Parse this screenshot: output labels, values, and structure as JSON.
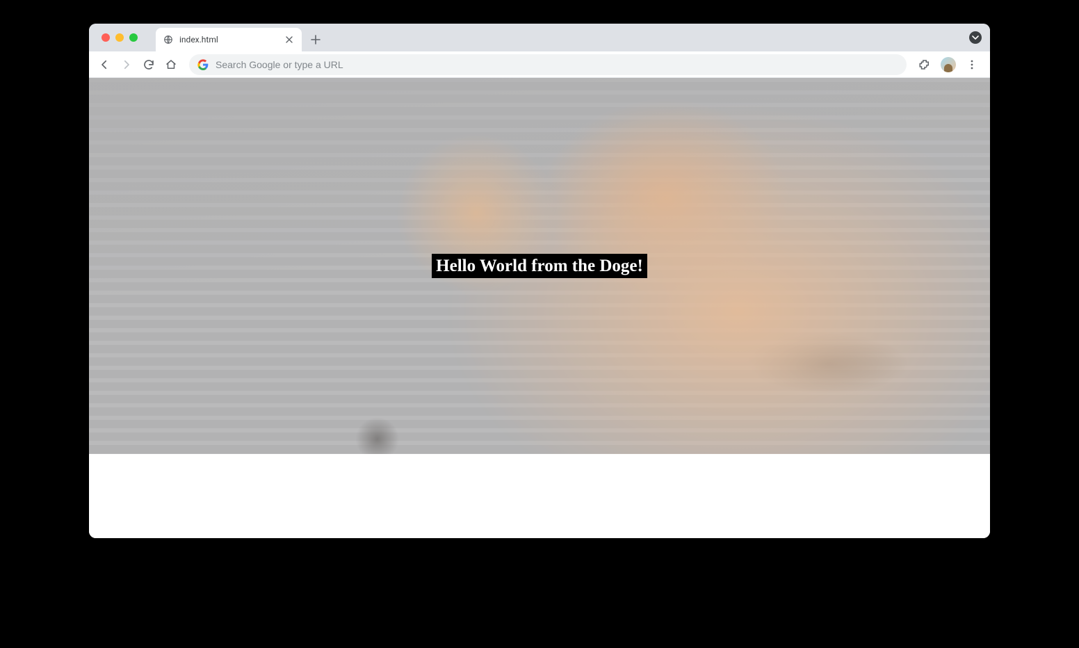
{
  "browser": {
    "tab_title": "index.html",
    "omnibox_placeholder": "Search Google or type a URL"
  },
  "page": {
    "heading": "Hello World from the Doge!"
  }
}
